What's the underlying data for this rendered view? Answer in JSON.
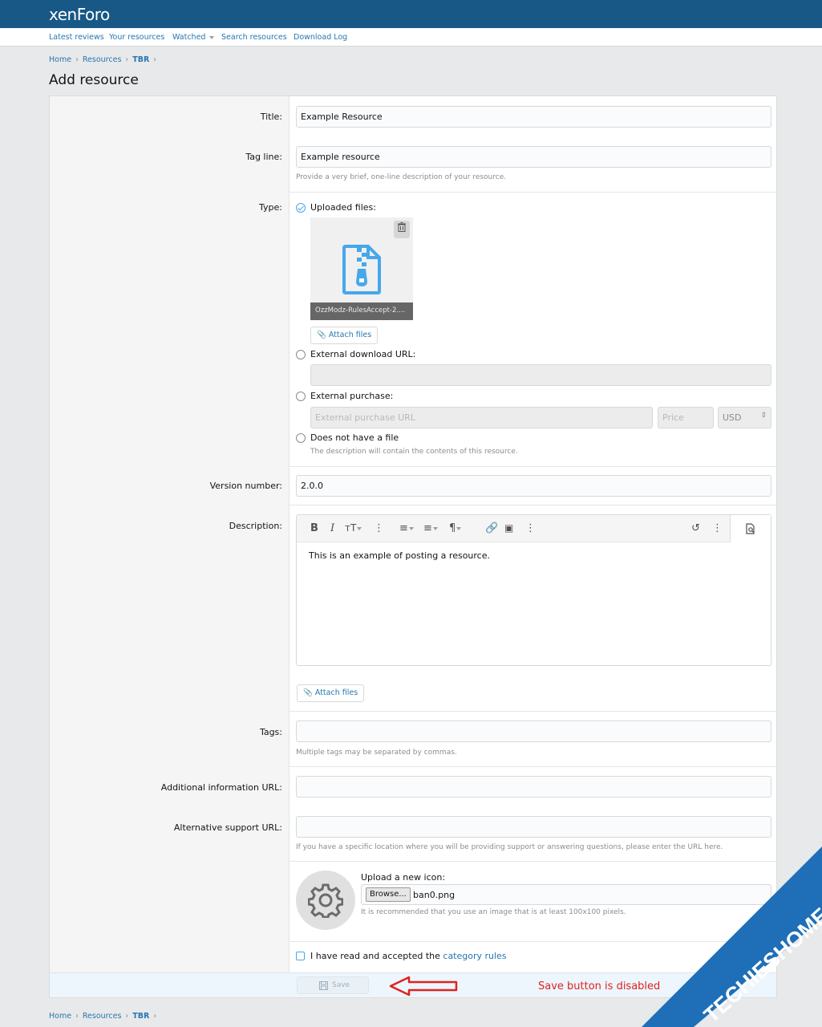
{
  "app": {
    "logo": "xenForo"
  },
  "subnav": [
    {
      "label": "Latest reviews"
    },
    {
      "label": "Your resources"
    },
    {
      "label": "Watched"
    },
    {
      "label": "Search resources"
    },
    {
      "label": "Download Log"
    }
  ],
  "breadcrumb": {
    "home": "Home",
    "resources": "Resources",
    "category": "TBR"
  },
  "page_title": "Add resource",
  "form": {
    "title": {
      "label": "Title:",
      "value": "Example Resource"
    },
    "tagline": {
      "label": "Tag line:",
      "value": "Example resource",
      "hint": "Provide a very brief, one-line description of your resource."
    },
    "type": {
      "label": "Type:",
      "uploaded": "Uploaded files:",
      "file_name": "OzzModz-RulesAccept-2....",
      "attach": "Attach files",
      "external_download": "External download URL:",
      "external_purchase": "External purchase:",
      "purchase_url_placeholder": "External purchase URL",
      "price_placeholder": "Price",
      "currency": "USD",
      "no_file": "Does not have a file",
      "no_file_hint": "The description will contain the contents of this resource."
    },
    "version": {
      "label": "Version number:",
      "value": "2.0.0"
    },
    "description": {
      "label": "Description:",
      "value": "This is an example of posting a resource.",
      "attach": "Attach files"
    },
    "tags": {
      "label": "Tags:",
      "value": "",
      "hint": "Multiple tags may be separated by commas."
    },
    "additional_url": {
      "label": "Additional information URL:",
      "value": ""
    },
    "support_url": {
      "label": "Alternative support URL:",
      "value": "",
      "hint": "If you have a specific location where you will be providing support or answering questions, please enter the URL here."
    },
    "icon": {
      "label": "Upload a new icon:",
      "browse": "Browse...",
      "file": "ban0.png",
      "hint": "It is recommended that you use an image that is at least 100x100 pixels."
    },
    "rules": {
      "prefix": "I have read and accepted the",
      "link": "category rules"
    },
    "save": "Save"
  },
  "annotation": {
    "text": "Save button is disabled"
  },
  "watermark": {
    "text": "TECHIESHOME.COM"
  },
  "colors": {
    "header": "#185886",
    "link": "#2577b1",
    "annotation": "#e0221f",
    "watermark": "#1e6fb8"
  }
}
